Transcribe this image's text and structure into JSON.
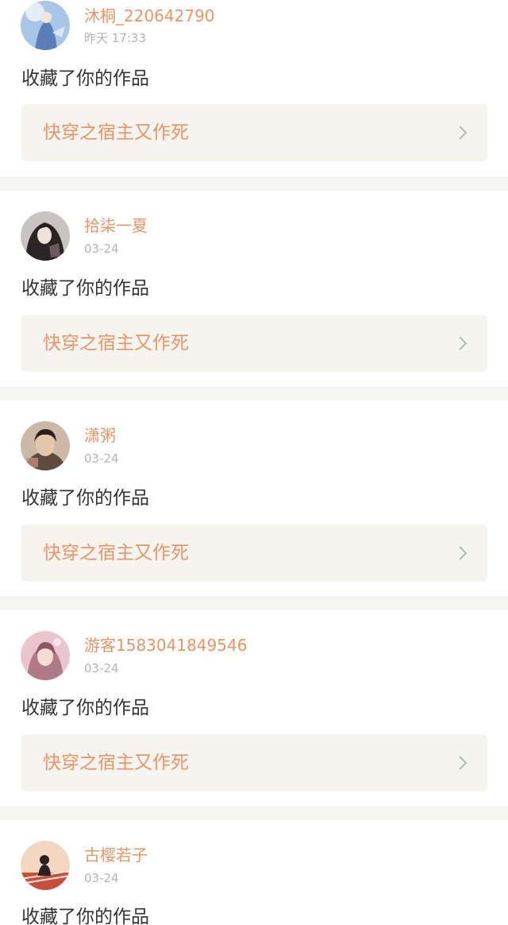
{
  "colors": {
    "accent": "#e8956a",
    "card_background": "#ffffff",
    "page_background": "#f5f5f3",
    "link_background": "#f5f4ee",
    "timestamp": "#b4b4b4",
    "action_text": "#333333"
  },
  "notifications": [
    {
      "username": "沐桐_220642790",
      "timestamp": "昨天 17:33",
      "action": "收藏了你的作品",
      "work_title": "快穿之宿主又作死",
      "avatar_icon": "avatar-anime-figure-icon"
    },
    {
      "username": "拾柒一夏",
      "timestamp": "03-24",
      "action": "收藏了你的作品",
      "work_title": "快穿之宿主又作死",
      "avatar_icon": "avatar-dark-portrait-icon"
    },
    {
      "username": "潇粥",
      "timestamp": "03-24",
      "action": "收藏了你的作品",
      "work_title": "快穿之宿主又作死",
      "avatar_icon": "avatar-boy-photo-icon"
    },
    {
      "username": "游客1583041849546",
      "timestamp": "03-24",
      "action": "收藏了你的作品",
      "work_title": "快穿之宿主又作死",
      "avatar_icon": "avatar-pink-portrait-icon"
    },
    {
      "username": "古樱若子",
      "timestamp": "03-24",
      "action": "收藏了你的作品",
      "work_title": "",
      "avatar_icon": "avatar-silhouette-scene-icon"
    }
  ]
}
